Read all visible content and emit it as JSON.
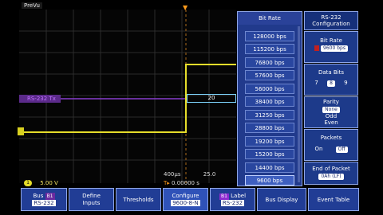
{
  "header": {
    "mode": "PreVu"
  },
  "waveform": {
    "bus_label": "RS-232 Tx",
    "bus_value": "20",
    "ch1_badge": "1",
    "ch1_scale": "5.00 V",
    "timebase": "400µs",
    "sample_rate": "25.0",
    "trigger_pos": "0.00000 s"
  },
  "bitrate_menu": {
    "title": "Bit Rate",
    "options": [
      "128000 bps",
      "115200 bps",
      "76800 bps",
      "57600 bps",
      "56000 bps",
      "38400 bps",
      "31250 bps",
      "28800 bps",
      "19200 bps",
      "15200 bps",
      "14400 bps",
      "9600 bps"
    ],
    "selected": "9600 bps"
  },
  "side_menu": {
    "title": "RS-232 Configuration",
    "bit_rate_label": "Bit Rate",
    "bit_rate_value": "9600 bps",
    "data_bits_label": "Data Bits",
    "data_bits_low": "7",
    "data_bits_value": "8",
    "data_bits_high": "9",
    "parity_label": "Parity",
    "parity_options": [
      "None",
      "Odd",
      "Even"
    ],
    "packets_label": "Packets",
    "packets_on": "On",
    "packets_off": "Off",
    "eop_label": "End of Packet",
    "eop_value": "0Ah (LF)"
  },
  "bottom_menu": {
    "bus_label": "Bus",
    "bus_chip": "B1",
    "bus_value": "RS-232",
    "define_inputs": "Define Inputs",
    "thresholds": "Thresholds",
    "configure": "Configure",
    "configure_value": "9600-8-N",
    "b1_label_chip": "B1",
    "b1_label": "Label",
    "b1_value": "RS-232",
    "bus_display": "Bus Display",
    "event_table": "Event Table"
  },
  "colors": {
    "ch1": "#e6dd2a",
    "bus": "#8a3ed0",
    "trigger": "#ff9a1a",
    "menu_bg": "#213d95"
  }
}
